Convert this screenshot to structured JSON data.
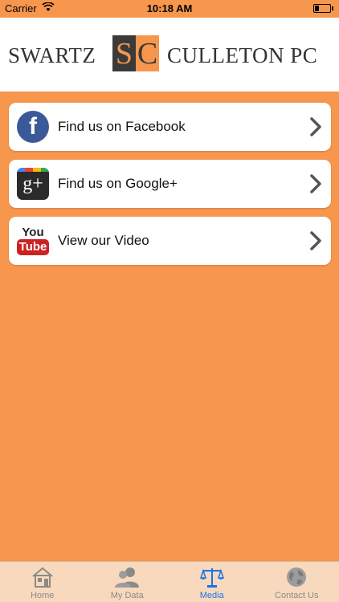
{
  "status_bar": {
    "carrier": "Carrier",
    "time": "10:18 AM"
  },
  "header": {
    "left_word": "SWARTZ",
    "logo_left": "S",
    "logo_right": "C",
    "right_word": "CULLETON PC"
  },
  "list": [
    {
      "label": "Find us on Facebook",
      "icon": "facebook-icon",
      "glyph": "f"
    },
    {
      "label": "Find us on Google+",
      "icon": "google-plus-icon",
      "glyph": "g+"
    },
    {
      "label": "View our Video",
      "icon": "youtube-icon",
      "glyph_top": "You",
      "glyph_bottom": "Tube"
    }
  ],
  "tabs": [
    {
      "label": "Home",
      "icon": "home-icon",
      "active": false
    },
    {
      "label": "My Data",
      "icon": "users-icon",
      "active": false
    },
    {
      "label": "Media",
      "icon": "scales-icon",
      "active": true
    },
    {
      "label": "Contact Us",
      "icon": "globe-icon",
      "active": false
    }
  ],
  "colors": {
    "background": "#F7964D",
    "tab_bar": "#F8D9BD",
    "active_tab": "#1a73e8",
    "facebook": "#3b5998",
    "youtube_red": "#cc2222"
  }
}
